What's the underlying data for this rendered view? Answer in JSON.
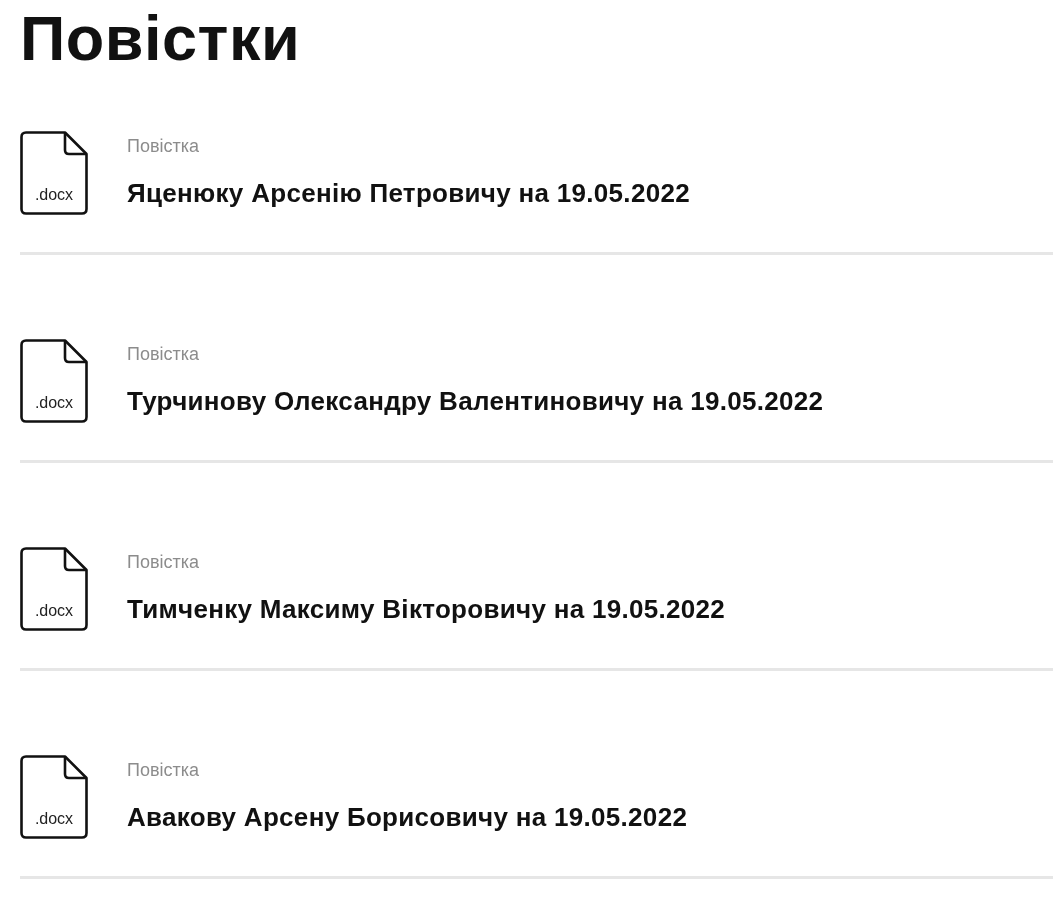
{
  "page_title": "Повістки",
  "documents": [
    {
      "file_type": ".docx",
      "label": "Повістка",
      "title": "Яценюку Арсенію Петровичу на 19.05.2022"
    },
    {
      "file_type": ".docx",
      "label": "Повістка",
      "title": "Турчинову Олександру Валентиновичу на 19.05.2022"
    },
    {
      "file_type": ".docx",
      "label": "Повістка",
      "title": "Тимченку Максиму Вікторовичу на 19.05.2022"
    },
    {
      "file_type": ".docx",
      "label": "Повістка",
      "title": "Авакову Арсену Борисовичу на 19.05.2022"
    }
  ]
}
